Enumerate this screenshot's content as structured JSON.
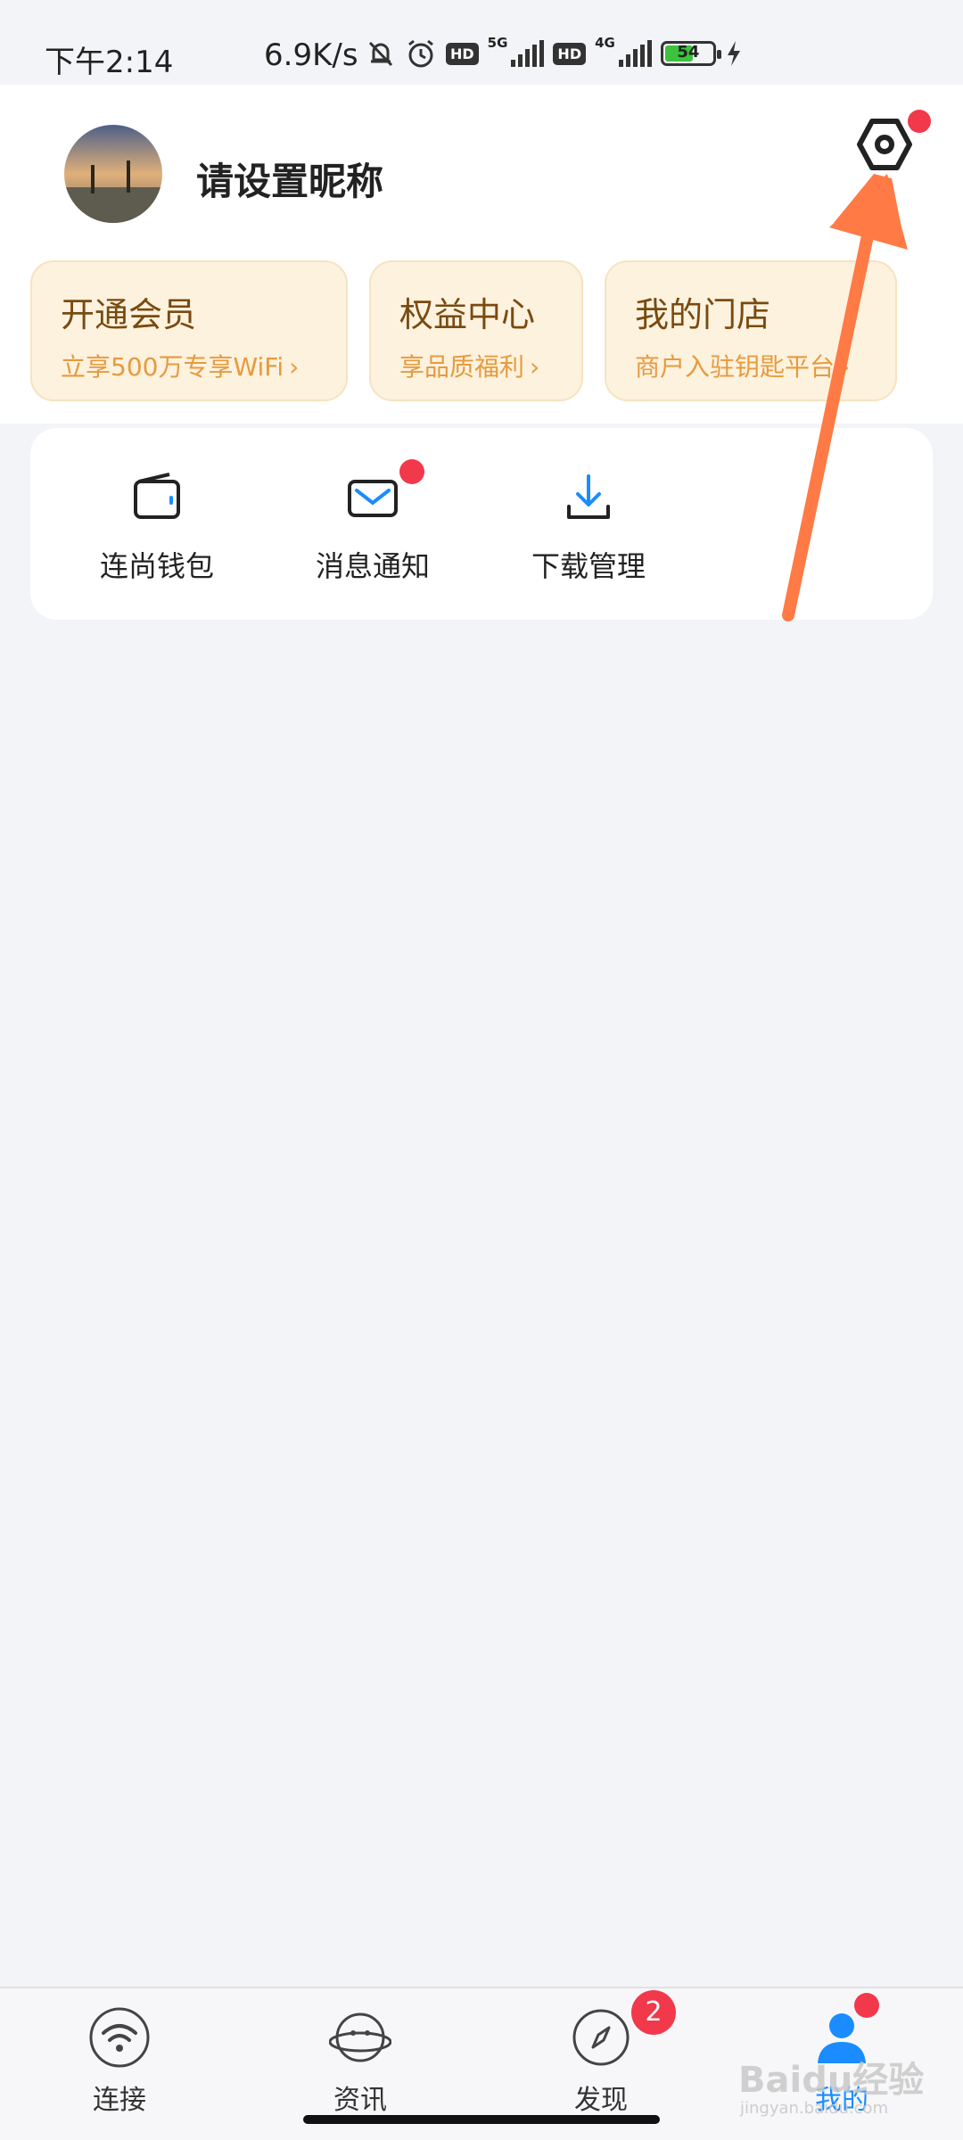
{
  "status_bar": {
    "time": "下午2:14",
    "speed": "6.9K/s",
    "hd1": "HD",
    "net1": "5G",
    "hd2": "HD",
    "net2": "4G",
    "battery": "54"
  },
  "profile": {
    "nickname": "请设置昵称",
    "settings_icon": "settings-icon",
    "settings_has_dot": true
  },
  "promos": [
    {
      "title": "开通会员",
      "subtitle": "立享500万专享WiFi",
      "chevron": "›"
    },
    {
      "title": "权益中心",
      "subtitle": "享品质福利",
      "chevron": "›"
    },
    {
      "title": "我的门店",
      "subtitle": "商户入驻钥匙平台",
      "chevron": "›"
    }
  ],
  "shortcuts": [
    {
      "label": "连尚钱包",
      "icon": "wallet-icon"
    },
    {
      "label": "消息通知",
      "icon": "mail-icon",
      "has_dot": true
    },
    {
      "label": "下载管理",
      "icon": "download-icon"
    }
  ],
  "bottom_nav": [
    {
      "label": "连接",
      "icon": "wifi-icon",
      "active": false
    },
    {
      "label": "资讯",
      "icon": "planet-icon",
      "active": false
    },
    {
      "label": "发现",
      "icon": "compass-icon",
      "active": false,
      "badge": "2"
    },
    {
      "label": "我的",
      "icon": "user-icon",
      "active": true,
      "has_dot": true
    }
  ],
  "watermark": {
    "brand": "Baidu经验",
    "url": "jingyan.baidu.com"
  },
  "colors": {
    "accent": "#1a8cff",
    "badge": "#f2384b",
    "annotation_arrow": "#ff7a45",
    "promo_bg": "#fdf2de",
    "promo_title": "#7a4a10",
    "promo_sub": "#e79a3e"
  }
}
